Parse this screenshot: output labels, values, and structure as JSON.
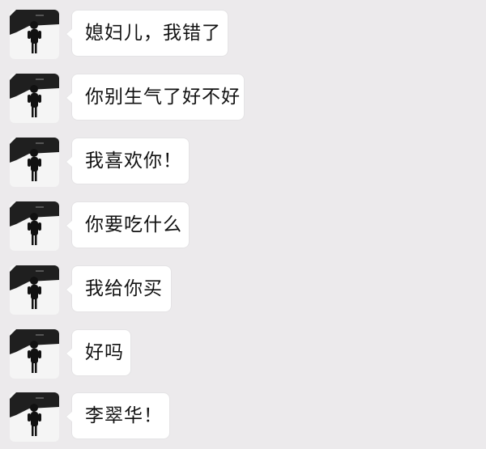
{
  "messages": [
    {
      "text": "媳妇儿，我错了",
      "avatar_icon": "user-avatar-icon"
    },
    {
      "text": "你别生气了好不好",
      "avatar_icon": "user-avatar-icon"
    },
    {
      "text": "我喜欢你！",
      "avatar_icon": "user-avatar-icon"
    },
    {
      "text": "你要吃什么",
      "avatar_icon": "user-avatar-icon"
    },
    {
      "text": "我给你买",
      "avatar_icon": "user-avatar-icon"
    },
    {
      "text": "好吗",
      "avatar_icon": "user-avatar-icon"
    },
    {
      "text": "李翠华！",
      "avatar_icon": "user-avatar-icon"
    }
  ],
  "colors": {
    "background": "#ECEAEC",
    "bubble": "#FFFFFF",
    "text": "#111111"
  }
}
